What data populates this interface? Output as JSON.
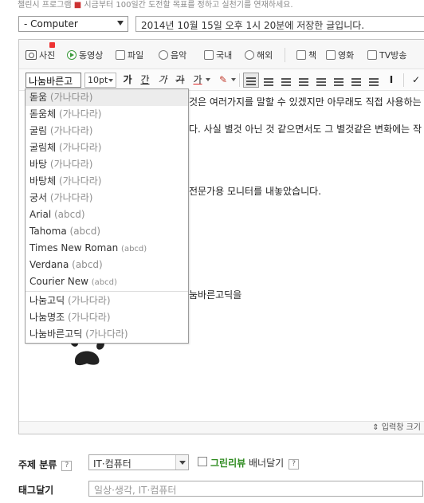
{
  "top_note": {
    "before": "챌린시 프로그램",
    "rest": "시금부터 100일간 도전할 목표를 정하고 실천기를 연재하세요."
  },
  "category_select": {
    "value": "- Computer"
  },
  "title_input": {
    "value": "2014년 10월 15일 오후 1시 20분에 저장한 글입니다."
  },
  "toolbar1": {
    "items": [
      {
        "label": "사진",
        "icon": "camera-icon"
      },
      {
        "label": "동영상",
        "icon": "play-icon"
      },
      {
        "label": "파일",
        "icon": "file-icon"
      },
      {
        "label": "음악",
        "icon": "music-icon"
      },
      {
        "label": "국내",
        "icon": "map-icon"
      },
      {
        "label": "해외",
        "icon": "globe-icon"
      },
      {
        "label": "책",
        "icon": "book-icon"
      },
      {
        "label": "영화",
        "icon": "movie-icon"
      },
      {
        "label": "TV방송",
        "icon": "tv-icon"
      }
    ]
  },
  "toolbar2": {
    "font_value": "나눔바른고",
    "size_value": "10pt",
    "format_buttons": [
      "가",
      "간",
      "가",
      "가",
      "가"
    ]
  },
  "content": {
    "line1": "것은 여러가지를 말할 수 있겠지만 아무래도 직접 사용하는",
    "line2": "다. 사실 별것 아닌 것 같으면서도 그 별것같은 변화에는 작",
    "line3": "전문가용 모니터를 내놓았습니다.",
    "line4": "눔바른고딕을"
  },
  "font_dropdown": {
    "items": [
      {
        "name": "돋움",
        "sample": "(가나다라)",
        "selected": true
      },
      {
        "name": "돋움체",
        "sample": "(가나다라)"
      },
      {
        "name": "굴림",
        "sample": "(가나다라)"
      },
      {
        "name": "굴림체",
        "sample": "(가나다라)"
      },
      {
        "name": "바탕",
        "sample": "(가나다라)"
      },
      {
        "name": "바탕체",
        "sample": "(가나다라)"
      },
      {
        "name": "궁서",
        "sample": "(가나다라)"
      },
      {
        "name": "Arial",
        "sample": "(abcd)"
      },
      {
        "name": "Tahoma",
        "sample": "(abcd)"
      },
      {
        "name": "Times New Roman",
        "sample": "(abcd)"
      },
      {
        "name": "Verdana",
        "sample": "(abcd)"
      },
      {
        "name": "Courier New",
        "sample": "(abcd)"
      },
      {
        "name": "나눔고딕",
        "sample": "(가나다라)"
      },
      {
        "name": "나눔명조",
        "sample": "(가나다라)"
      },
      {
        "name": "나눔바른고딕",
        "sample": "(가나다라)"
      }
    ]
  },
  "resize_label": "⇕ 입력창 크기",
  "subject": {
    "label": "주제 분류",
    "help": "?",
    "value": "IT·컴퓨터"
  },
  "green_review": {
    "label": "그린리뷰",
    "rest": " 배너달기",
    "help": "?"
  },
  "tag": {
    "label": "태그달기",
    "value": "일상·생각, IT·컴퓨터"
  },
  "colors": {
    "green": "#2e8b1f",
    "dropdown_selected_bg": "#ececec"
  }
}
